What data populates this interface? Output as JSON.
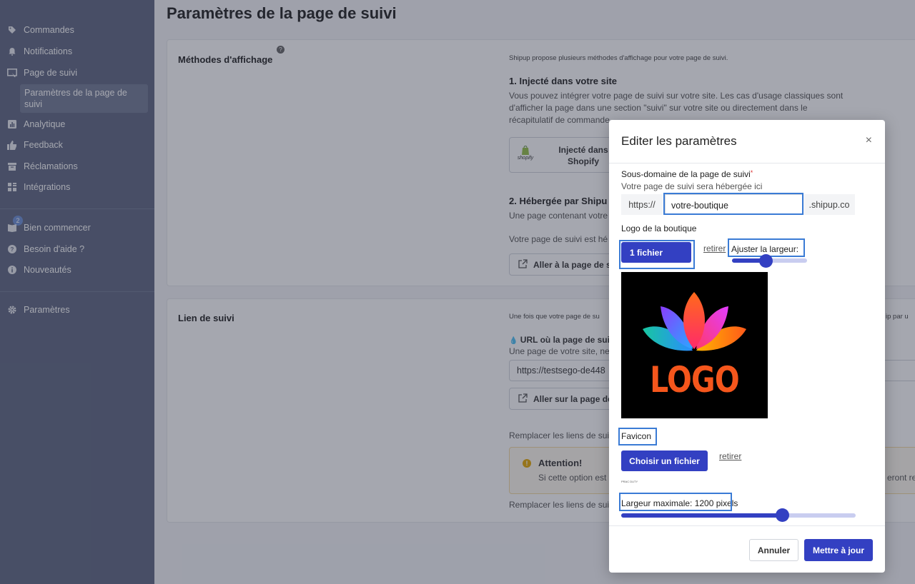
{
  "sidebar": {
    "items": [
      {
        "label": "Commandes",
        "icon": "tag-icon"
      },
      {
        "label": "Notifications",
        "icon": "bell-icon"
      },
      {
        "label": "Page de suivi",
        "icon": "monitor-icon"
      },
      {
        "label": "Analytique",
        "icon": "chart-icon"
      },
      {
        "label": "Feedback",
        "icon": "thumbs-up-icon"
      },
      {
        "label": "Réclamations",
        "icon": "inbox-icon"
      },
      {
        "label": "Intégrations",
        "icon": "grid-icon"
      }
    ],
    "sub_item": "Paramètres de la page de suivi",
    "bottom_items": [
      {
        "label": "Bien commencer",
        "icon": "book-icon"
      },
      {
        "label": "Besoin d'aide ?",
        "icon": "help-icon"
      },
      {
        "label": "Nouveautés",
        "icon": "info-icon"
      }
    ],
    "badge_count": "2",
    "settings_label": "Paramètres"
  },
  "main": {
    "title": "Paramètres de la page de suivi",
    "methods": {
      "label": "Méthodes d'affichage",
      "intro": "Shipup propose plusieurs méthodes d'affichage pour votre page de suivi.",
      "opt1_title": "1. Injecté dans votre site",
      "opt1_desc_1": "Vous pouvez intégrer votre page de suivi sur votre site. Les cas d'usage classiques sont",
      "opt1_desc_2": "d'afficher la page dans une section \"suivi\" sur votre site ou directement dans le",
      "opt1_desc_3": "récapitulatif de commande",
      "shopify_word": "shopify",
      "shopify_btn_line1": "Injecté dans",
      "shopify_btn_line2": "Shopify",
      "opt2_title": "2. Hébergée par Shipu",
      "opt2_desc": "Une page contenant votre",
      "opt2_note": "Votre page de suivi est hé",
      "goto_btn": "Aller à la page de s"
    },
    "tracking_link": {
      "label": "Lien de suivi",
      "intro": "Une fois que votre page de su",
      "intro_right": "ip par u",
      "url_title": "URL où la page de suiv",
      "url_desc": "Une page de votre site, ne",
      "url_value": "https://testsego-de448",
      "goto_btn": "Aller sur la page de",
      "replace_1": "Remplacer les liens de sui",
      "warn_title": "Attention!",
      "warn_desc": "Si cette option est",
      "warn_right": "eront re",
      "replace_2": "Remplacer les liens de sui"
    }
  },
  "modal": {
    "title": "Editer les paramètres",
    "close": "×",
    "subdomain_label": "Sous-domaine de la page de suivi",
    "required_mark": "*",
    "subdomain_help": "Votre page de suivi sera hébergée ici",
    "prefix": "https://",
    "subdomain_value": "votre-boutique",
    "suffix": ".shipup.co",
    "logo_label": "Logo de la boutique",
    "logo_file_btn": "1 fichier",
    "remove_link": "retirer",
    "width_label": "Ajuster la largeur:",
    "logo_width_level": 0.45,
    "logo_text": "LOGO",
    "favicon_label": "Favicon",
    "favicon_btn": "Choisir un fichier",
    "favicon_remove": "retirer",
    "favicon_thumb_text": "PRAC DUTY",
    "max_width_label": "Largeur maximale: 1200 pixels",
    "max_width_level": 0.65,
    "cancel": "Annuler",
    "submit": "Mettre à jour"
  },
  "colors": {
    "sidebar_bg": "#5f6781",
    "primary": "#3340c2",
    "highlight": "#3a7bd5"
  }
}
